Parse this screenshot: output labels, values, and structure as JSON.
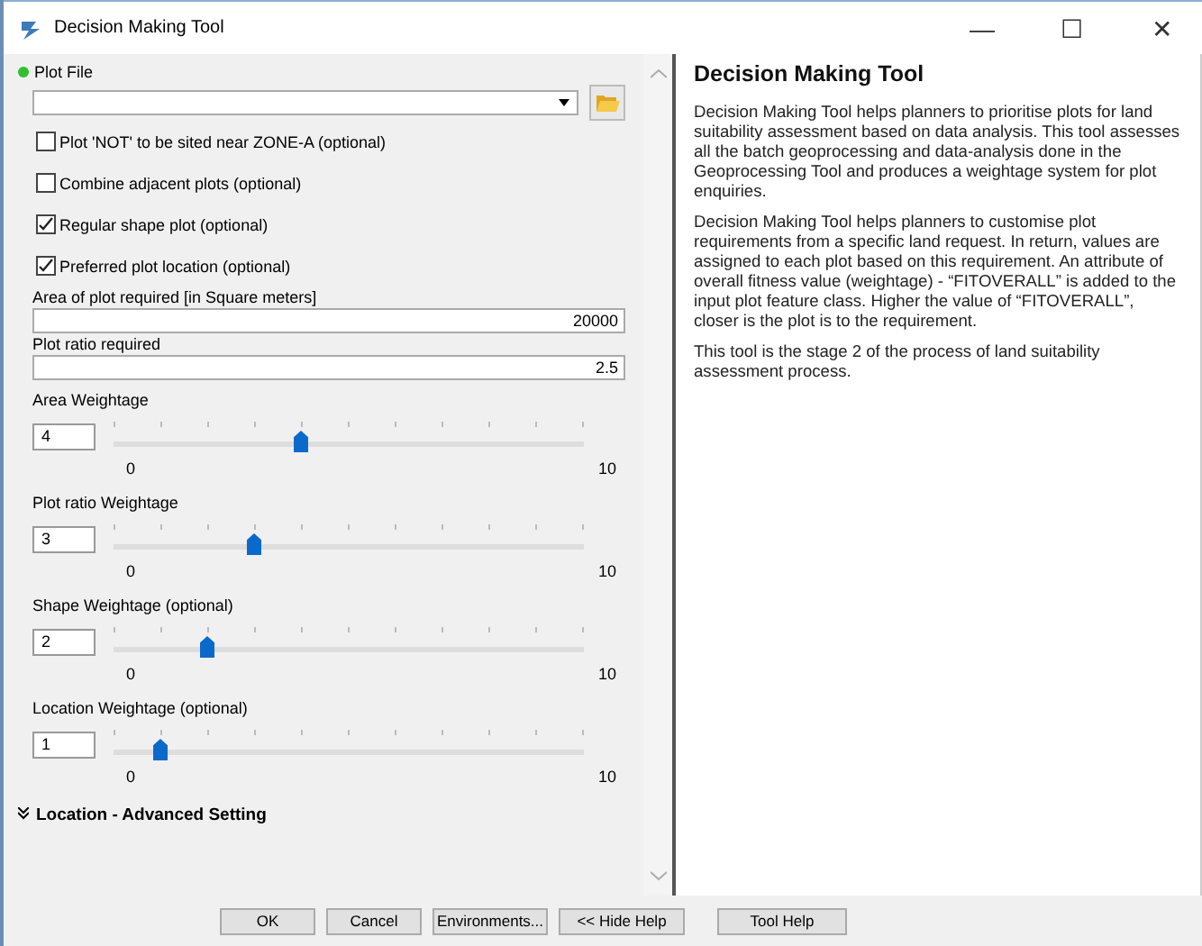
{
  "window": {
    "title": "Decision Making Tool",
    "controls": [
      "—",
      "☐",
      "✕"
    ]
  },
  "plot_file": {
    "label": "Plot File",
    "required": true
  },
  "checkboxes": [
    {
      "label": "Plot 'NOT' to be sited near ZONE-A (optional)",
      "checked": false
    },
    {
      "label": "Combine adjacent plots (optional)",
      "checked": false
    },
    {
      "label": "Regular shape plot (optional)",
      "checked": true
    },
    {
      "label": "Preferred plot location (optional)",
      "checked": true
    }
  ],
  "fields": [
    {
      "label": "Area of plot required [in Square meters]",
      "value": "20000"
    },
    {
      "label": "Plot ratio required",
      "value": "2.5"
    }
  ],
  "sliders": [
    {
      "label": "Area Weightage",
      "value": "4",
      "level": 0.4,
      "min": "0",
      "max": "10"
    },
    {
      "label": "Plot ratio Weightage",
      "value": "3",
      "level": 0.3,
      "min": "0",
      "max": "10"
    },
    {
      "label": "Shape Weightage (optional)",
      "value": "2",
      "level": 0.2,
      "min": "0",
      "max": "10"
    },
    {
      "label": "Location Weightage (optional)",
      "value": "1",
      "level": 0.1,
      "min": "0",
      "max": "10"
    }
  ],
  "section": {
    "label": "Location - Advanced Setting",
    "expanded": false
  },
  "help": {
    "title": "Decision Making Tool",
    "paragraphs": [
      "Decision Making Tool helps planners to prioritise plots for land suitability assessment based on data analysis. This tool assesses all the batch geoprocessing and data-analysis done in the Geoprocessing Tool and produces a weightage system for plot enquiries.",
      "Decision Making Tool helps planners to customise plot requirements from a specific land request. In return, values are assigned to each plot based on this requirement. An attribute of overall fitness value (weightage) - “FITOVERALL” is added to the input plot feature class. Higher the value of “FITOVERALL”, closer is the plot is to the requirement.",
      "This tool is the stage 2 of the process of land suitability assessment process."
    ]
  },
  "buttons": [
    "OK",
    "Cancel",
    "Environments...",
    "<< Hide Help"
  ],
  "help_button": "Tool Help"
}
